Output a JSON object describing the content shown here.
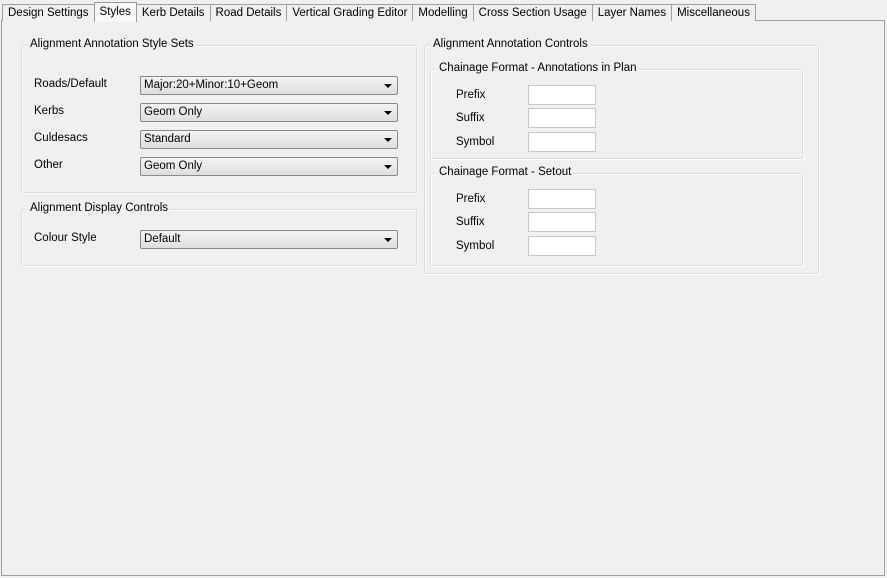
{
  "tabs": [
    "Design Settings",
    "Styles",
    "Kerb Details",
    "Road Details",
    "Vertical Grading Editor",
    "Modelling",
    "Cross Section Usage",
    "Layer Names",
    "Miscellaneous"
  ],
  "active_tab": "Styles",
  "annotation_style_sets": {
    "title": "Alignment Annotation Style Sets",
    "rows": [
      {
        "label": "Roads/Default",
        "value": "Major:20+Minor:10+Geom"
      },
      {
        "label": "Kerbs",
        "value": "Geom Only"
      },
      {
        "label": "Culdesacs",
        "value": "Standard"
      },
      {
        "label": "Other",
        "value": "Geom Only"
      }
    ]
  },
  "display_controls": {
    "title": "Alignment Display Controls",
    "colour_style_label": "Colour Style",
    "colour_style_value": "Default"
  },
  "annotation_controls": {
    "title": "Alignment Annotation Controls",
    "plan": {
      "title": "Chainage Format - Annotations in Plan",
      "prefix_label": "Prefix",
      "prefix_value": "",
      "suffix_label": "Suffix",
      "suffix_value": "",
      "symbol_label": "Symbol",
      "symbol_value": ""
    },
    "setout": {
      "title": "Chainage Format - Setout",
      "prefix_label": "Prefix",
      "prefix_value": "",
      "suffix_label": "Suffix",
      "suffix_value": "",
      "symbol_label": "Symbol",
      "symbol_value": ""
    }
  }
}
